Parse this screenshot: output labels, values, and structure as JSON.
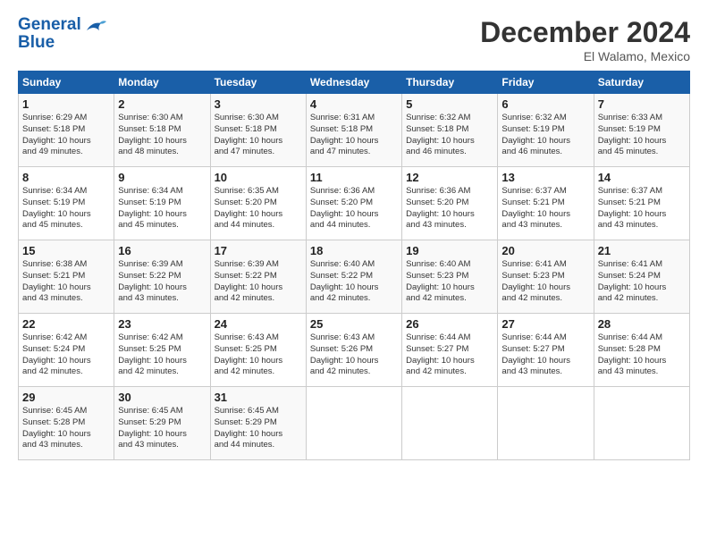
{
  "logo": {
    "line1": "General",
    "line2": "Blue"
  },
  "header": {
    "month": "December 2024",
    "location": "El Walamo, Mexico"
  },
  "weekdays": [
    "Sunday",
    "Monday",
    "Tuesday",
    "Wednesday",
    "Thursday",
    "Friday",
    "Saturday"
  ],
  "weeks": [
    [
      {
        "day": "1",
        "info": "Sunrise: 6:29 AM\nSunset: 5:18 PM\nDaylight: 10 hours\nand 49 minutes."
      },
      {
        "day": "2",
        "info": "Sunrise: 6:30 AM\nSunset: 5:18 PM\nDaylight: 10 hours\nand 48 minutes."
      },
      {
        "day": "3",
        "info": "Sunrise: 6:30 AM\nSunset: 5:18 PM\nDaylight: 10 hours\nand 47 minutes."
      },
      {
        "day": "4",
        "info": "Sunrise: 6:31 AM\nSunset: 5:18 PM\nDaylight: 10 hours\nand 47 minutes."
      },
      {
        "day": "5",
        "info": "Sunrise: 6:32 AM\nSunset: 5:18 PM\nDaylight: 10 hours\nand 46 minutes."
      },
      {
        "day": "6",
        "info": "Sunrise: 6:32 AM\nSunset: 5:19 PM\nDaylight: 10 hours\nand 46 minutes."
      },
      {
        "day": "7",
        "info": "Sunrise: 6:33 AM\nSunset: 5:19 PM\nDaylight: 10 hours\nand 45 minutes."
      }
    ],
    [
      {
        "day": "8",
        "info": "Sunrise: 6:34 AM\nSunset: 5:19 PM\nDaylight: 10 hours\nand 45 minutes."
      },
      {
        "day": "9",
        "info": "Sunrise: 6:34 AM\nSunset: 5:19 PM\nDaylight: 10 hours\nand 45 minutes."
      },
      {
        "day": "10",
        "info": "Sunrise: 6:35 AM\nSunset: 5:20 PM\nDaylight: 10 hours\nand 44 minutes."
      },
      {
        "day": "11",
        "info": "Sunrise: 6:36 AM\nSunset: 5:20 PM\nDaylight: 10 hours\nand 44 minutes."
      },
      {
        "day": "12",
        "info": "Sunrise: 6:36 AM\nSunset: 5:20 PM\nDaylight: 10 hours\nand 43 minutes."
      },
      {
        "day": "13",
        "info": "Sunrise: 6:37 AM\nSunset: 5:21 PM\nDaylight: 10 hours\nand 43 minutes."
      },
      {
        "day": "14",
        "info": "Sunrise: 6:37 AM\nSunset: 5:21 PM\nDaylight: 10 hours\nand 43 minutes."
      }
    ],
    [
      {
        "day": "15",
        "info": "Sunrise: 6:38 AM\nSunset: 5:21 PM\nDaylight: 10 hours\nand 43 minutes."
      },
      {
        "day": "16",
        "info": "Sunrise: 6:39 AM\nSunset: 5:22 PM\nDaylight: 10 hours\nand 43 minutes."
      },
      {
        "day": "17",
        "info": "Sunrise: 6:39 AM\nSunset: 5:22 PM\nDaylight: 10 hours\nand 42 minutes."
      },
      {
        "day": "18",
        "info": "Sunrise: 6:40 AM\nSunset: 5:22 PM\nDaylight: 10 hours\nand 42 minutes."
      },
      {
        "day": "19",
        "info": "Sunrise: 6:40 AM\nSunset: 5:23 PM\nDaylight: 10 hours\nand 42 minutes."
      },
      {
        "day": "20",
        "info": "Sunrise: 6:41 AM\nSunset: 5:23 PM\nDaylight: 10 hours\nand 42 minutes."
      },
      {
        "day": "21",
        "info": "Sunrise: 6:41 AM\nSunset: 5:24 PM\nDaylight: 10 hours\nand 42 minutes."
      }
    ],
    [
      {
        "day": "22",
        "info": "Sunrise: 6:42 AM\nSunset: 5:24 PM\nDaylight: 10 hours\nand 42 minutes."
      },
      {
        "day": "23",
        "info": "Sunrise: 6:42 AM\nSunset: 5:25 PM\nDaylight: 10 hours\nand 42 minutes."
      },
      {
        "day": "24",
        "info": "Sunrise: 6:43 AM\nSunset: 5:25 PM\nDaylight: 10 hours\nand 42 minutes."
      },
      {
        "day": "25",
        "info": "Sunrise: 6:43 AM\nSunset: 5:26 PM\nDaylight: 10 hours\nand 42 minutes."
      },
      {
        "day": "26",
        "info": "Sunrise: 6:44 AM\nSunset: 5:27 PM\nDaylight: 10 hours\nand 42 minutes."
      },
      {
        "day": "27",
        "info": "Sunrise: 6:44 AM\nSunset: 5:27 PM\nDaylight: 10 hours\nand 43 minutes."
      },
      {
        "day": "28",
        "info": "Sunrise: 6:44 AM\nSunset: 5:28 PM\nDaylight: 10 hours\nand 43 minutes."
      }
    ],
    [
      {
        "day": "29",
        "info": "Sunrise: 6:45 AM\nSunset: 5:28 PM\nDaylight: 10 hours\nand 43 minutes."
      },
      {
        "day": "30",
        "info": "Sunrise: 6:45 AM\nSunset: 5:29 PM\nDaylight: 10 hours\nand 43 minutes."
      },
      {
        "day": "31",
        "info": "Sunrise: 6:45 AM\nSunset: 5:29 PM\nDaylight: 10 hours\nand 44 minutes."
      },
      null,
      null,
      null,
      null
    ]
  ]
}
